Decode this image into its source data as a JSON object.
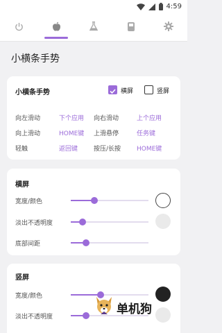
{
  "status_bar": {
    "time": "4:59",
    "icons": [
      "wifi-icon",
      "signal-icon",
      "battery-icon"
    ]
  },
  "tabs": [
    {
      "icon": "power-icon",
      "active": false
    },
    {
      "icon": "apple-icon",
      "active": true
    },
    {
      "icon": "flask-icon",
      "active": false
    },
    {
      "icon": "sd-card-icon",
      "active": false
    },
    {
      "icon": "gear-icon",
      "active": false
    }
  ],
  "page_title": "小横条手势",
  "gesture_card": {
    "title": "小横条手势",
    "landscape": {
      "label": "横屏",
      "checked": true
    },
    "portrait": {
      "label": "竖屏",
      "checked": false
    },
    "rows": [
      {
        "left_label": "向左滑动",
        "left_value": "下个应用",
        "right_label": "向右滑动",
        "right_value": "上个应用"
      },
      {
        "left_label": "向上滑动",
        "left_value": "HOME键",
        "right_label": "上滑悬停",
        "right_value": "任务键"
      },
      {
        "left_label": "轻触",
        "left_value": "返回键",
        "right_label": "按压/长按",
        "right_value": "HOME键"
      }
    ]
  },
  "landscape_card": {
    "title": "横屏",
    "width_color": {
      "label": "宽度/颜色",
      "level": 0.3,
      "color": "#ffffff"
    },
    "fade_opacity": {
      "label": "淡出不透明度",
      "level": 0.15,
      "color": "#eaeaea"
    },
    "bottom_margin": {
      "label": "底部间距",
      "level": 0.2
    }
  },
  "portrait_card": {
    "title": "竖屏",
    "width_color": {
      "label": "宽度/颜色",
      "level": 0.38,
      "color": "#222222"
    },
    "fade_opacity": {
      "label": "淡出不透明度",
      "level": 0.2,
      "color": "#eaeaea"
    }
  },
  "watermark": {
    "text": "单机狗"
  },
  "colors": {
    "accent": "#9b6bd9",
    "track": "#e3dcee",
    "background": "#f1f1f3"
  }
}
